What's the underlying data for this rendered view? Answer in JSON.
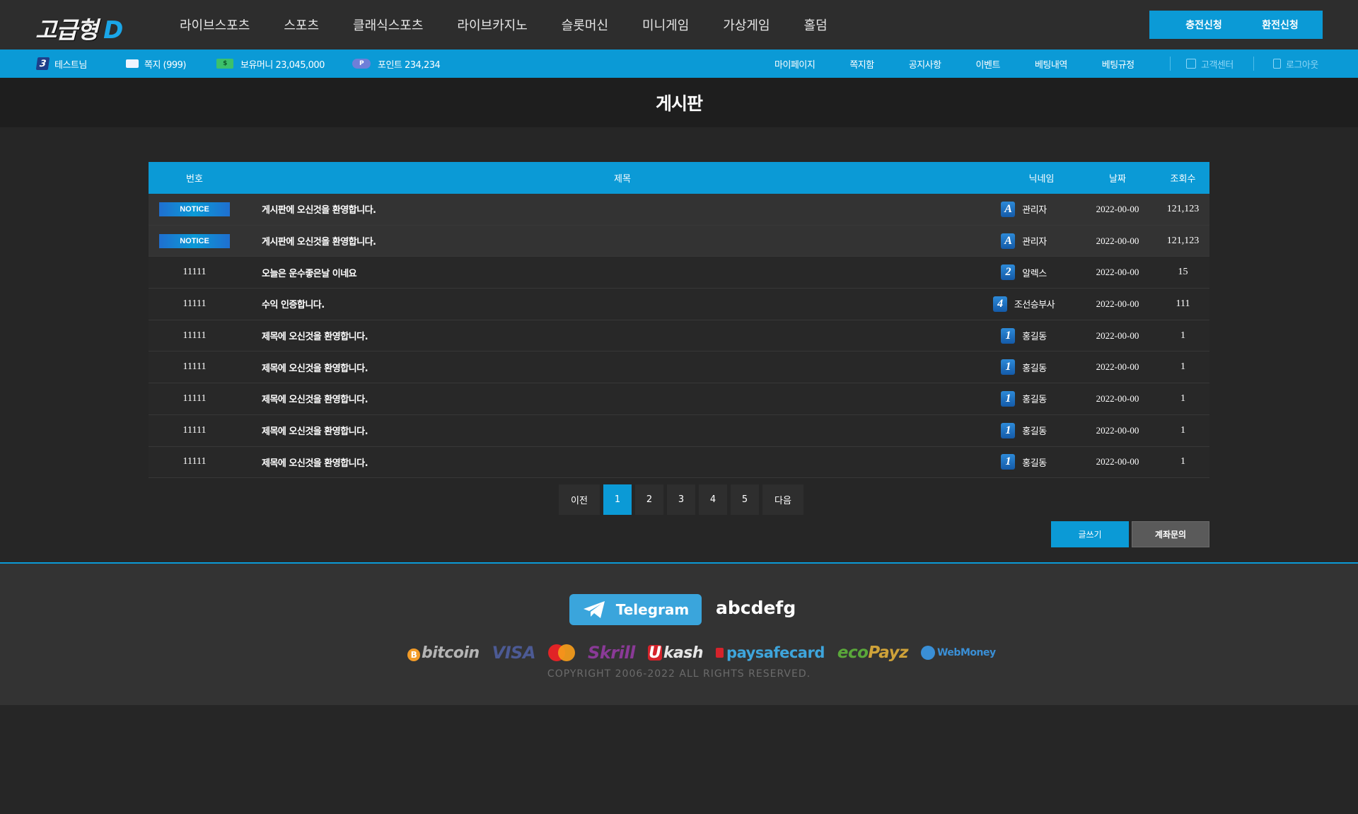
{
  "header": {
    "logo_text": "고급형",
    "logo_suffix": "D",
    "nav": [
      "라이브스포츠",
      "스포츠",
      "클래식스포츠",
      "라이브카지노",
      "슬롯머신",
      "미니게임",
      "가상게임",
      "홀덤"
    ],
    "deposit_label": "충전신청",
    "withdraw_label": "환전신청"
  },
  "userbar": {
    "level": "3",
    "username": "테스트님",
    "messages": "쪽지 (999)",
    "money": "보유머니 23,045,000",
    "points": "포인트 234,234",
    "links": [
      "마이페이지",
      "쪽지함",
      "공지사항",
      "이벤트",
      "베팅내역",
      "베팅규정"
    ],
    "support_label": "고객센터",
    "logout_label": "로그아웃"
  },
  "page": {
    "title": "게시판"
  },
  "board": {
    "columns": [
      "번호",
      "제목",
      "닉네임",
      "날짜",
      "조회수"
    ],
    "notice_label": "NOTICE",
    "rows": [
      {
        "no": "NOTICE",
        "title": "게시판에 오신것을 환영합니다.",
        "level": "A",
        "nick": "관리자",
        "date": "2022-00-00",
        "views": "121,123"
      },
      {
        "no": "NOTICE",
        "title": "게시판에 오신것을 환영합니다.",
        "level": "A",
        "nick": "관리자",
        "date": "2022-00-00",
        "views": "121,123"
      },
      {
        "no": "11111",
        "title": "오늘은 운수좋은날 이네요",
        "level": "2",
        "nick": "알렉스",
        "date": "2022-00-00",
        "views": "15"
      },
      {
        "no": "11111",
        "title": "수익 인증합니다.",
        "level": "4",
        "nick": "조선승부사",
        "date": "2022-00-00",
        "views": "111"
      },
      {
        "no": "11111",
        "title": "제목에 오신것을 환영합니다.",
        "level": "1",
        "nick": "홍길동",
        "date": "2022-00-00",
        "views": "1"
      },
      {
        "no": "11111",
        "title": "제목에 오신것을 환영합니다.",
        "level": "1",
        "nick": "홍길동",
        "date": "2022-00-00",
        "views": "1"
      },
      {
        "no": "11111",
        "title": "제목에 오신것을 환영합니다.",
        "level": "1",
        "nick": "홍길동",
        "date": "2022-00-00",
        "views": "1"
      },
      {
        "no": "11111",
        "title": "제목에 오신것을 환영합니다.",
        "level": "1",
        "nick": "홍길동",
        "date": "2022-00-00",
        "views": "1"
      },
      {
        "no": "11111",
        "title": "제목에 오신것을 환영합니다.",
        "level": "1",
        "nick": "홍길동",
        "date": "2022-00-00",
        "views": "1"
      }
    ]
  },
  "pagination": {
    "prev_label": "이전",
    "pages": [
      "1",
      "2",
      "3",
      "4",
      "5"
    ],
    "active_page": "1",
    "next_label": "다음"
  },
  "actions": {
    "write_label": "글쓰기",
    "account_inquiry_label": "계좌문의"
  },
  "footer": {
    "telegram_label": "Telegram",
    "telegram_id": "abcdefg",
    "payments": {
      "bitcoin": "bitcoin",
      "visa": "VISA",
      "skrill": "Skrill",
      "ukash": "kash",
      "paysafecard": "paysafecard",
      "ecopayz_eco": "eco",
      "ecopayz_payz": "Payz",
      "webmoney": "WebMoney"
    },
    "copyright": "COPYRIGHT  2006-2022  ALL RIGHTS RESERVED."
  },
  "colors": {
    "accent": "#0b9ad6",
    "background": "#262626",
    "header_bg": "#2d2d2d"
  }
}
